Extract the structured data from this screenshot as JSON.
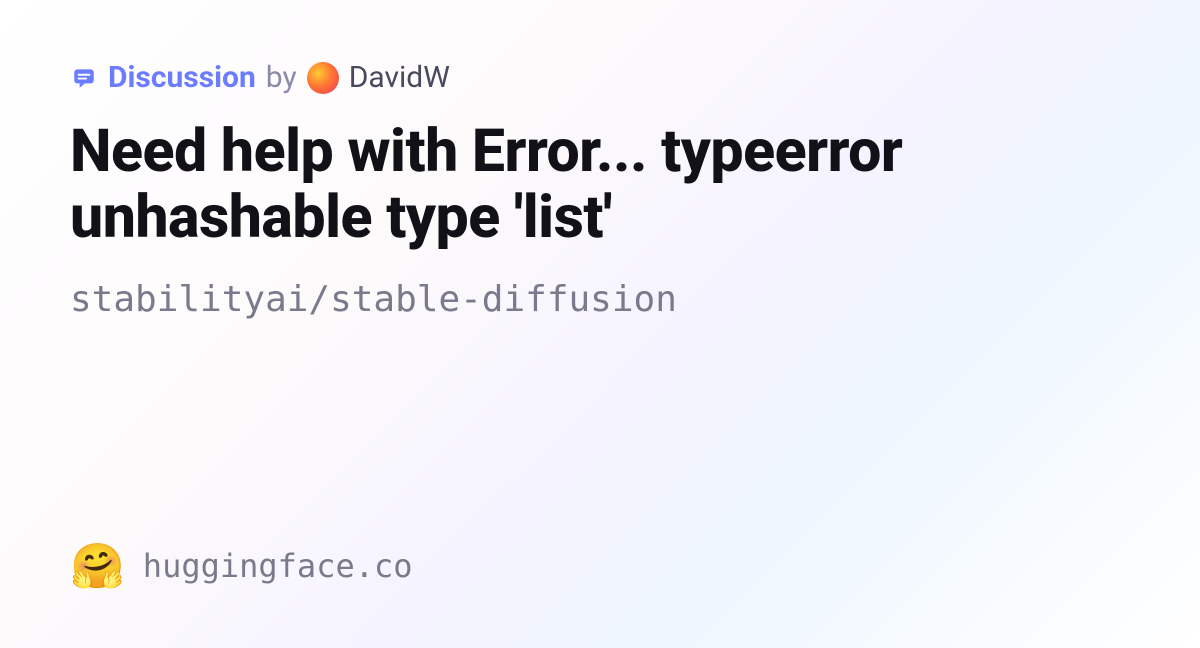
{
  "header": {
    "discussion_label": "Discussion",
    "by_text": "by",
    "username": "DavidW"
  },
  "title": "Need help with Error... typeerror unhashable type 'list'",
  "repo_path": "stabilityai/stable-diffusion",
  "footer": {
    "emoji": "🤗",
    "site_url": "huggingface.co"
  }
}
